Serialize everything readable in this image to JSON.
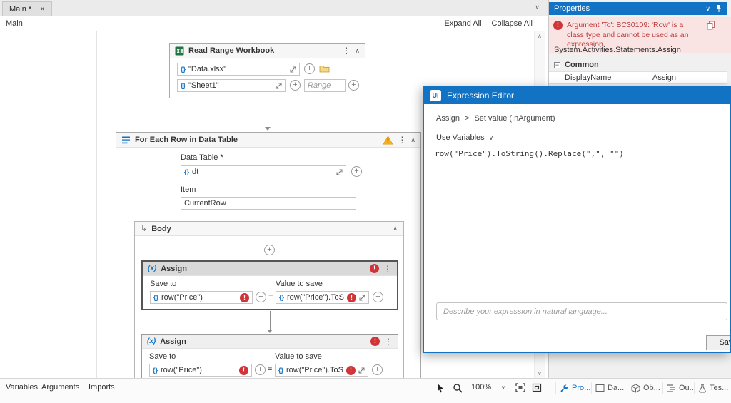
{
  "colors": {
    "accent_blue": "#1273c4",
    "error_red": "#d13438",
    "warning_orange": "#fcb017",
    "excel_green": "#217346"
  },
  "icons": {
    "close": "×",
    "chevron_down": "∨",
    "chevron_up": "∧",
    "dots": "⋮",
    "plus": "+",
    "error": "!",
    "equals": "=",
    "braces": "{}",
    "assign": "(x)",
    "body_arrow": "↳",
    "breadcrumb_sep": ">",
    "minus": "−"
  },
  "top_bar": {
    "tab_label": "Main *"
  },
  "breadcrumb_bar": {
    "root": "Main",
    "expand_all": "Expand All",
    "collapse_all": "Collapse All"
  },
  "canvas": {
    "read_range": {
      "title": "Read Range Workbook",
      "file_value": "\"Data.xlsx\"",
      "sheet_value": "\"Sheet1\"",
      "range_placeholder": "Range"
    },
    "for_each": {
      "title": "For Each Row in Data Table",
      "data_table_label": "Data Table *",
      "data_table_value": "dt",
      "item_label": "Item",
      "item_value": "CurrentRow",
      "body_label": "Body"
    },
    "assign1": {
      "title": "Assign",
      "save_to_label": "Save to",
      "value_to_save_label": "Value to save",
      "save_to_value": "row(\"Price\")",
      "value_to_save_value": "row(\"Price\").ToStrin"
    },
    "assign2": {
      "title": "Assign",
      "save_to_label": "Save to",
      "value_to_save_label": "Value to save",
      "save_to_value": "row(\"Price\")",
      "value_to_save_value": "row(\"Price\").ToStrin"
    }
  },
  "properties": {
    "title": "Properties",
    "error_text": "Argument 'To': BC30109: 'Row' is a class type and cannot be used as an expression.",
    "class_name": "System.Activities.Statements.Assign",
    "common_label": "Common",
    "display_name_label": "DisplayName",
    "display_name_value": "Assign"
  },
  "expression_editor": {
    "title": "Expression Editor",
    "logo": "Ui",
    "crumb_activity": "Assign",
    "crumb_property": "Set value (InArgument)",
    "use_variables_label": "Use Variables",
    "expression": "row(\"Price\").ToString().Replace(\",\", \"\")",
    "nl_placeholder": "Describe your expression in natural language...",
    "save_label": "Save"
  },
  "status_bar": {
    "variables": "Variables",
    "arguments": "Arguments",
    "imports": "Imports",
    "zoom": "100%",
    "panels": [
      {
        "label": "Pro..."
      },
      {
        "label": "Da..."
      },
      {
        "label": "Ob..."
      },
      {
        "label": "Ou..."
      },
      {
        "label": "Tes..."
      }
    ]
  }
}
